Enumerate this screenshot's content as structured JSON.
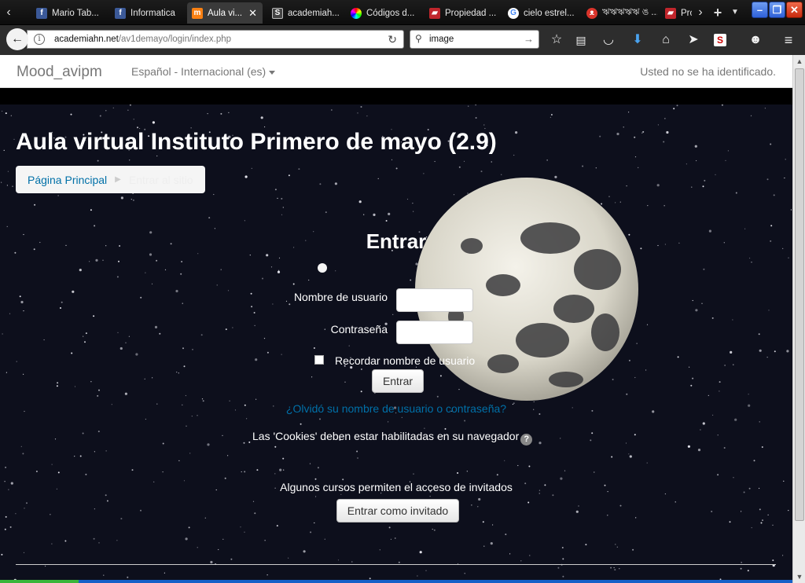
{
  "browser": {
    "tabs": [
      {
        "title": "Mario Tab...",
        "icon": "facebook-icon",
        "color": "#3b5998",
        "glyph": "f"
      },
      {
        "title": "Informatica",
        "icon": "facebook-icon",
        "color": "#3b5998",
        "glyph": "f"
      },
      {
        "title": "Aula vi...",
        "icon": "moodle-icon",
        "color": "#f98012",
        "glyph": "m",
        "active": true
      },
      {
        "title": "academiah...",
        "icon": "s-icon",
        "color": "#444444",
        "glyph": "S"
      },
      {
        "title": "Códigos d...",
        "icon": "color-wheel-icon",
        "color": "#cc3366",
        "glyph": "●"
      },
      {
        "title": "Propiedad ...",
        "icon": "book-icon",
        "color": "#c0262c",
        "glyph": "▰"
      },
      {
        "title": "cielo estrel...",
        "icon": "google-icon",
        "color": "#4285f4",
        "glyph": "G"
      },
      {
        "title": "ঋঋঋঋঋ ঙ ...",
        "icon": "owl-icon",
        "color": "#d9342b",
        "glyph": "ᴥ"
      },
      {
        "title": "Pro",
        "icon": "book-icon",
        "color": "#c0262c",
        "glyph": "▰"
      }
    ],
    "url_domain": "academiahn.net",
    "url_path": "/av1demayo/login/index.php",
    "search_value": "image"
  },
  "page": {
    "brand": "Mood_avipm",
    "language": "Español - Internacional (es)",
    "login_status": "Usted no se ha identificado.",
    "title": "Aula virtual Instituto Primero de mayo (2.9)",
    "breadcrumb": {
      "home": "Página Principal",
      "current": "Entrar al sitio"
    },
    "login": {
      "heading": "Entrar",
      "username_label": "Nombre de usuario",
      "username_value": "",
      "password_label": "Contraseña",
      "password_value": "",
      "remember_label": "Recordar nombre de usuario",
      "remember_checked": false,
      "submit_label": "Entrar",
      "forgot_link": "¿Olvidó su nombre de usuario o contraseña?",
      "cookies_note": "Las 'Cookies' deben estar habilitadas en su navegador",
      "guest_note": "Algunos cursos permiten el acceso de invitados",
      "guest_button": "Entrar como invitado"
    }
  }
}
